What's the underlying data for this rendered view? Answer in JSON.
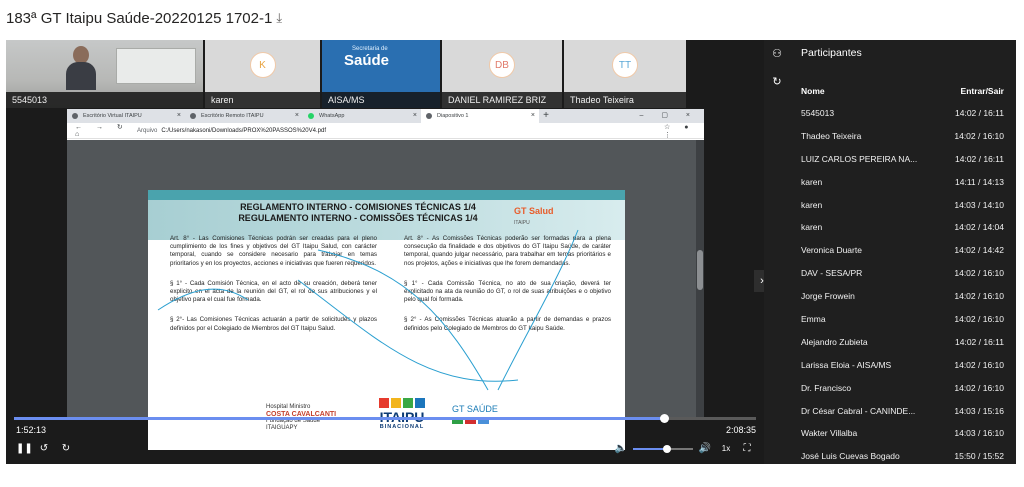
{
  "title": "183ª GT Itaipu Saúde-20220125 1702-1",
  "download_icon": "download-icon",
  "tiles": [
    {
      "caption": "5545013",
      "kind": "camera"
    },
    {
      "caption": "karen",
      "initials": "K",
      "color": "#e8a341"
    },
    {
      "caption": "AISA/MS",
      "kind": "camera",
      "logo": "Saúde",
      "logo_sub": "Secretaria de"
    },
    {
      "caption": "DANIEL RAMIREZ BRIZ",
      "initials": "DB",
      "color": "#e07a6a"
    },
    {
      "caption": "Thadeo Teixeira",
      "initials": "TT",
      "color": "#5aa7d6"
    }
  ],
  "browser": {
    "tabs": [
      {
        "label": "Escritório Virtual ITAIPU"
      },
      {
        "label": "Escritório Remoto ITAIPU"
      },
      {
        "label": "WhatsApp"
      },
      {
        "label": "Diapositivo 1"
      }
    ],
    "address_prefix": "Arquivo",
    "address": "C:/Users/nakasoni/Downloads/PROX%20PASSOS%20V4.pdf"
  },
  "slide": {
    "title_line1": "REGLAMENTO INTERNO - COMISIONES TÉCNICAS 1/4",
    "title_line2": "REGULAMENTO INTERNO - COMISSÕES TÉCNICAS 1/4",
    "gt_logo": "GT Salud",
    "gt_logo_sub": "ITAIPU",
    "left": [
      "Art. 8° - Las Comisiones Técnicas podrán ser creadas para el pleno cumplimiento de los fines y objetivos del GT Itaipu Salud, con carácter temporal, cuando se considere necesario para trabajar en temas prioritarios y en los proyectos, acciones e iniciativas que fueren requeridos.",
      "§ 1° - Cada Comisión Técnica, en el acto de su creación, deberá tener explicito en el acta de la reunión del GT, el rol de sus atribuciones y el objetivo para el cual fue formada.",
      "§ 2°- Las Comisiones Técnicas actuarán a partir de solicitudes y plazos definidos por el Colegiado de Miembros del GT Itaipu Salud."
    ],
    "right": [
      "Art. 8° - As Comissões Técnicas poderão ser formadas para a plena consecução da finalidade e dos objetivos do GT Itaipu Saúde, de caráter temporal, quando julgar necessário, para trabalhar em temas prioritários e nos projetos, ações e iniciativas que lhe forem demandadas.",
      "§ 1° - Cada Comissão Técnica, no ato de sua criação, deverá ter explicitado na ata da reunião do GT, o rol de suas atribuições e o objetivo pelo qual foi formada.",
      "§ 2° - As Comissões Técnicas atuarão a partir de demandas e prazos definidos pelo Colegiado de Membros do GT Itaipu Saúde."
    ],
    "logo1_line1": "Hospital Ministro",
    "logo1_line2": "COSTA CAVALCANTI",
    "logo1_line3": "Fundação de Saúde",
    "logo1_line4": "ITAIGUAPY",
    "logo2_name": "ITAIPU",
    "logo2_sub": "BINACIONAL",
    "logo3": "GT SAÚDE"
  },
  "player": {
    "current_time": "1:52:13",
    "total_time": "2:08:35",
    "progress": 0.877,
    "volume": 0.57,
    "speed": "1x"
  },
  "panel": {
    "title": "Participantes",
    "col_name": "Nome",
    "col_time": "Entrar/Sair",
    "participants": [
      {
        "name": "5545013",
        "time": "14:02 / 16:11"
      },
      {
        "name": "Thadeo Teixeira",
        "time": "14:02 / 16:10"
      },
      {
        "name": "LUIZ CARLOS PEREIRA NA...",
        "time": "14:02 / 16:11"
      },
      {
        "name": "karen",
        "time": "14:11 / 14:13"
      },
      {
        "name": "karen",
        "time": "14:03 / 14:10"
      },
      {
        "name": "karen",
        "time": "14:02 / 14:04"
      },
      {
        "name": "Veronica Duarte",
        "time": "14:02 / 14:42"
      },
      {
        "name": "DAV - SESA/PR",
        "time": "14:02 / 16:10"
      },
      {
        "name": "Jorge Frowein",
        "time": "14:02 / 16:10"
      },
      {
        "name": "Emma",
        "time": "14:02 / 16:10"
      },
      {
        "name": "Alejandro Zubieta",
        "time": "14:02 / 16:11"
      },
      {
        "name": "Larissa Eloia - AISA/MS",
        "time": "14:02 / 16:10"
      },
      {
        "name": "Dr. Francisco",
        "time": "14:02 / 16:10"
      },
      {
        "name": "Dr César Cabral - CANINDE...",
        "time": "14:03 / 15:16"
      },
      {
        "name": "Wakter Villalba",
        "time": "14:03 / 16:10"
      },
      {
        "name": "José Luis Cuevas Bogado",
        "time": "15:50 / 15:52"
      }
    ]
  }
}
